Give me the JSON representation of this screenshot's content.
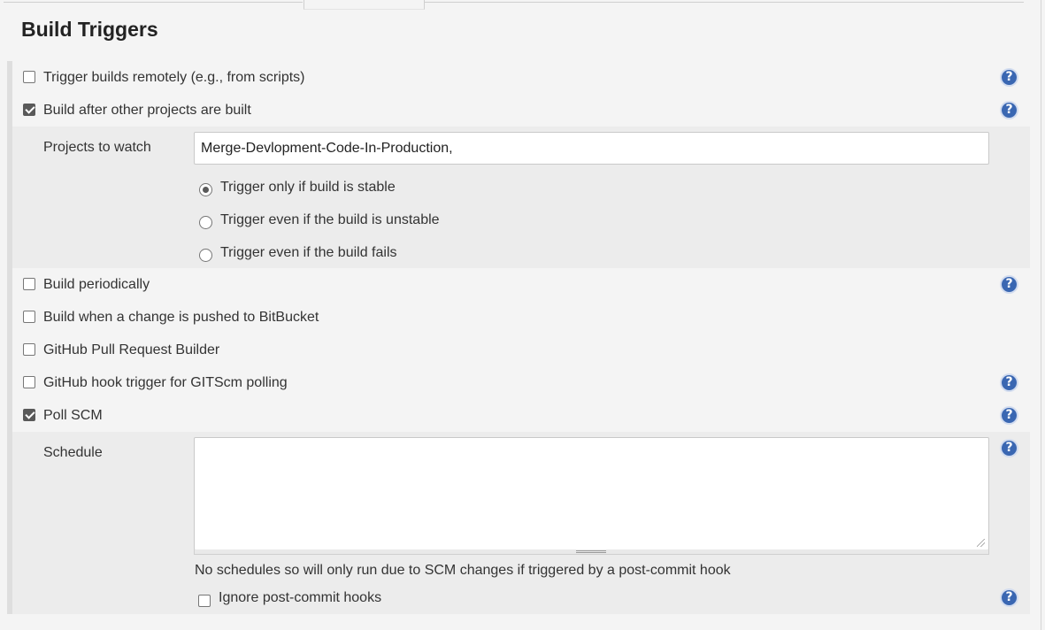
{
  "section": {
    "title": "Build Triggers"
  },
  "triggers": {
    "remote": {
      "label": "Trigger builds remotely (e.g., from scripts)",
      "checked": false
    },
    "after_other": {
      "label": "Build after other projects are built",
      "checked": true,
      "projects_label": "Projects to watch",
      "projects_value": "Merge-Devlopment-Code-In-Production,",
      "options": [
        {
          "label": "Trigger only if build is stable",
          "selected": true
        },
        {
          "label": "Trigger even if the build is unstable",
          "selected": false
        },
        {
          "label": "Trigger even if the build fails",
          "selected": false
        }
      ]
    },
    "periodic": {
      "label": "Build periodically",
      "checked": false
    },
    "bitbucket": {
      "label": "Build when a change is pushed to BitBucket",
      "checked": false
    },
    "github_pr": {
      "label": "GitHub Pull Request Builder",
      "checked": false
    },
    "github_hook": {
      "label": "GitHub hook trigger for GITScm polling",
      "checked": false
    },
    "poll_scm": {
      "label": "Poll SCM",
      "checked": true,
      "schedule_label": "Schedule",
      "schedule_value": "",
      "schedule_note": "No schedules so will only run due to SCM changes if triggered by a post-commit hook",
      "ignore_hooks_label": "Ignore post-commit hooks",
      "ignore_hooks_checked": false
    }
  },
  "help": {
    "glyph": "?"
  },
  "colors": {
    "help_blue": "#3a67b2",
    "subsection_bg": "#ececec",
    "page_bg": "#f4f4f4"
  }
}
